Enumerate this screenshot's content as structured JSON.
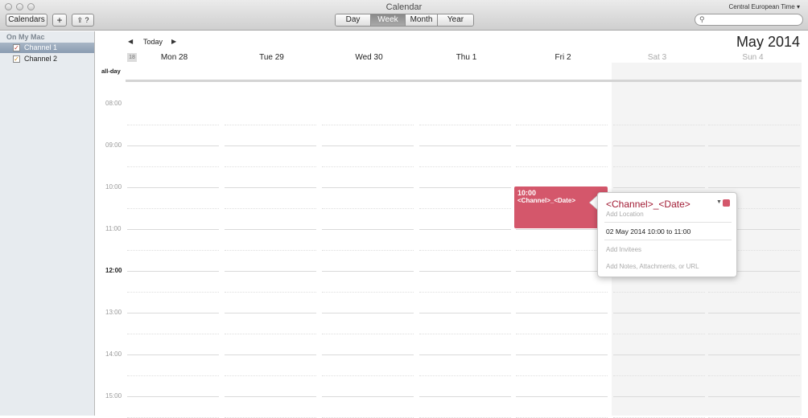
{
  "window": {
    "title": "Calendar"
  },
  "toolbar": {
    "calendars_label": "Calendars",
    "add_label": "+",
    "import_label": "⇪ ?",
    "views": [
      "Day",
      "Week",
      "Month",
      "Year"
    ],
    "active_view": "Week",
    "timezone": "Central European Time ▾",
    "search_placeholder": ""
  },
  "sidebar": {
    "section": "On My Mac",
    "calendars": [
      {
        "label": "Channel 1",
        "checked": true,
        "selected": true,
        "color": "#d4576b"
      },
      {
        "label": "Channel 2",
        "checked": true,
        "selected": false,
        "color": "#e8a33c"
      }
    ]
  },
  "nav": {
    "prev": "◀",
    "today": "Today",
    "next": "▶"
  },
  "header": {
    "month_year": "May 2014",
    "week_number": "18",
    "allday_label": "all-day"
  },
  "days": [
    "Mon 28",
    "Tue 29",
    "Wed 30",
    "Thu 1",
    "Fri 2",
    "Sat 3",
    "Sun 4"
  ],
  "hours": [
    "08:00",
    "09:00",
    "10:00",
    "11:00",
    "12:00",
    "13:00",
    "14:00",
    "15:00"
  ],
  "event": {
    "time": "10:00",
    "title": "<Channel>_<Date>",
    "color": "#d4576b"
  },
  "popover": {
    "title": "<Channel>_<Date>",
    "location_placeholder": "Add Location",
    "datetime": "02 May 2014  10:00 to 11:00",
    "invitees_placeholder": "Add Invitees",
    "notes_placeholder": "Add Notes, Attachments, or URL"
  }
}
